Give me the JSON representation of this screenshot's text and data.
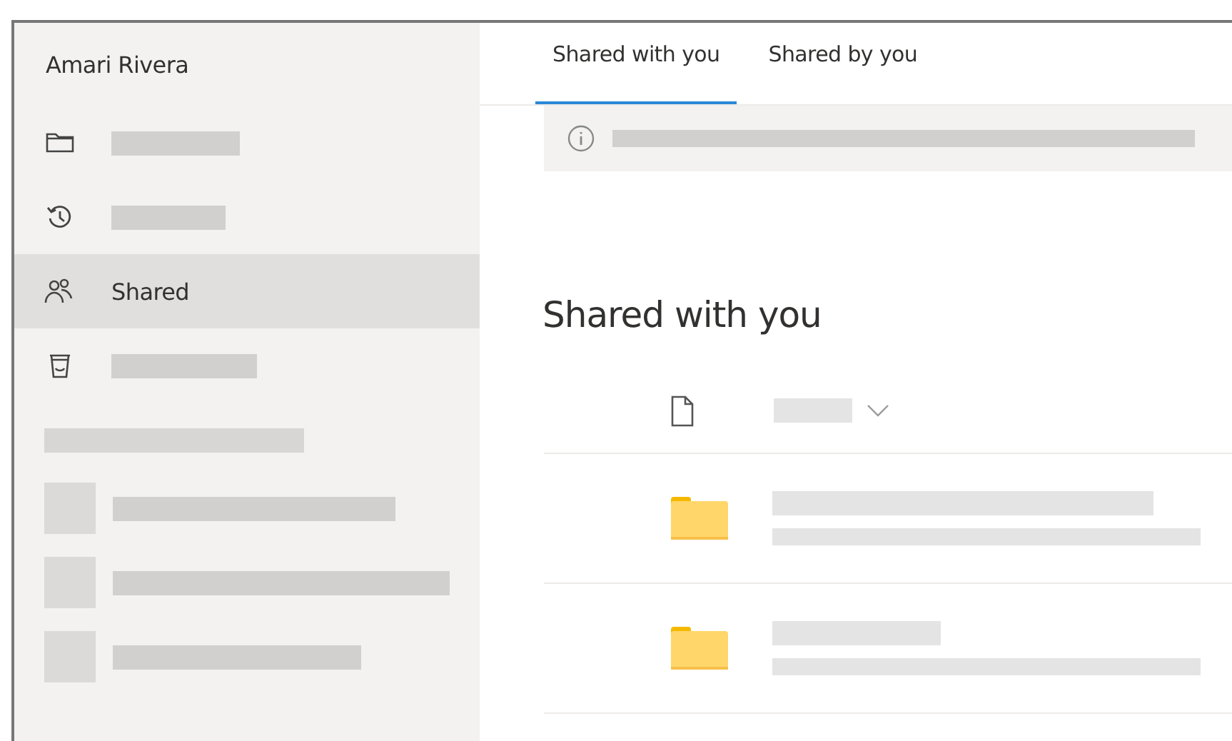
{
  "sidebar": {
    "account_name": "Amari Rivera",
    "items": [
      {
        "selected": false
      },
      {
        "selected": false
      },
      {
        "label": "Shared",
        "selected": true
      },
      {
        "selected": false
      }
    ]
  },
  "tabs": [
    {
      "label": "Shared with you",
      "selected": true
    },
    {
      "label": "Shared by you",
      "selected": false
    }
  ],
  "heading": "Shared with you"
}
